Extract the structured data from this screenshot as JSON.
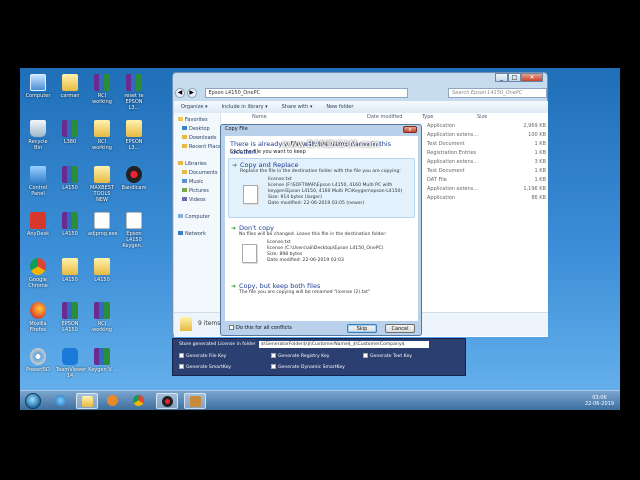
{
  "watermark": "www.BANDICAM.com",
  "desktop_icons": [
    {
      "label": "Computer",
      "icon": "computer-icon"
    },
    {
      "label": "carman",
      "icon": "folder-icon"
    },
    {
      "label": "RCI working",
      "icon": "winrar-icon"
    },
    {
      "label": "reset te EPSON L3...",
      "icon": "winrar-icon"
    },
    {
      "label": "Recycle Bin",
      "icon": "recycle-bin-icon"
    },
    {
      "label": "L380",
      "icon": "winrar-icon"
    },
    {
      "label": "RCI working",
      "icon": "folder-icon"
    },
    {
      "label": "EPSON L3...",
      "icon": "folder-icon"
    },
    {
      "label": "Control Panel",
      "icon": "control-panel-icon"
    },
    {
      "label": "L4150",
      "icon": "winrar-icon"
    },
    {
      "label": "MAXBEST TOOLS NEW",
      "icon": "folder-icon"
    },
    {
      "label": "Bandicam",
      "icon": "bandicam-icon"
    },
    {
      "label": "AnyDesk",
      "icon": "anydesk-icon"
    },
    {
      "label": "L4150",
      "icon": "winrar-icon"
    },
    {
      "label": "adjprog.exe",
      "icon": "document-icon"
    },
    {
      "label": "Epson L4150 Keygen...",
      "icon": "document-icon"
    },
    {
      "label": "Google Chrome",
      "icon": "chrome-icon"
    },
    {
      "label": "L4150",
      "icon": "folder-icon"
    },
    {
      "label": "L4150",
      "icon": "folder-icon"
    },
    {
      "label": "Mozilla Firefox",
      "icon": "firefox-icon"
    },
    {
      "label": "EPSON L4150",
      "icon": "winrar-icon"
    },
    {
      "label": "RCI working",
      "icon": "winrar-icon"
    },
    {
      "label": "PowerISO",
      "icon": "poweriso-icon"
    },
    {
      "label": "TeamViewer 14",
      "icon": "teamviewer-icon"
    },
    {
      "label": "Keygen V...",
      "icon": "winrar-icon"
    }
  ],
  "explorer": {
    "address": "Epson L4150_OnePC",
    "search_placeholder": "Search Epson L4150_OnePC",
    "toolbar": [
      "Organize ▾",
      "Include in library ▾",
      "Share with ▾",
      "New folder"
    ],
    "nav": [
      "Favorites",
      "Desktop",
      "Downloads",
      "Recent Places",
      "Libraries",
      "Documents",
      "Music",
      "Pictures",
      "Videos",
      "Computer",
      "Network"
    ],
    "columns": {
      "name": "Name",
      "date": "Date modified",
      "type": "Type",
      "size": "Size"
    },
    "files": [
      {
        "type": "Application",
        "size": "2,969 KB"
      },
      {
        "type": "Application extens...",
        "size": "100 KB"
      },
      {
        "type": "Text Document",
        "size": "1 KB"
      },
      {
        "type": "Registration Entries",
        "size": "1 KB"
      },
      {
        "type": "Application extens...",
        "size": "3 KB"
      },
      {
        "type": "Text Document",
        "size": "1 KB"
      },
      {
        "type": "DAT File",
        "size": "1 KB"
      },
      {
        "type": "Application extens...",
        "size": "1,196 KB"
      },
      {
        "type": "Application",
        "size": "86 KB"
      }
    ],
    "status": "9 items"
  },
  "dialog": {
    "title": "Copy File",
    "close": "x",
    "heading": "There is already a file with the same name in this location.",
    "subheading": "Click the file you want to keep",
    "opt1": {
      "label": "Copy and Replace",
      "desc1": "Replace the file in the destination folder with the file you are copying:",
      "name": "license.txt",
      "path1": "license (F:\\SOFTWAR\\Epson L4150, 4160 Multi PC with",
      "path2": "keygen\\Epson L4150, 4160 Multi PC\\Keygen\\epson-L4150)",
      "size": "Size: 914 bytes (larger)",
      "date": "Date modified: 22-06-2019 03:05 (newer)"
    },
    "opt2": {
      "label": "Don't copy",
      "desc1": "No files will be changed. Leave this file in the destination folder:",
      "name": "license.txt",
      "path1": "license (C:\\Users\\ali\\Desktop\\Epson L4150_OnePC)",
      "size": "Size: 898 bytes",
      "date": "Date modified: 22-06-2019 03:03"
    },
    "opt3": {
      "label": "Copy, but keep both files",
      "desc1": "The file you are copying will be renamed \"license (2).txt\""
    },
    "all_conflicts": "Do this for all conflicts",
    "skip": "Skip",
    "cancel": "Cancel"
  },
  "keygen": {
    "store_label": "Store generated License in folder",
    "store_value": "$\\GeneratorFolder$\\$\\CustomerName$_$\\CustomerCompany$",
    "checks": [
      "Generate File Key",
      "Generate Registry Key",
      "Generate Text Key",
      "Generate SmartKey",
      "Generate Dynamic SmartKey"
    ]
  },
  "taskbar": {
    "time": "03:06",
    "date": "22-06-2019"
  }
}
